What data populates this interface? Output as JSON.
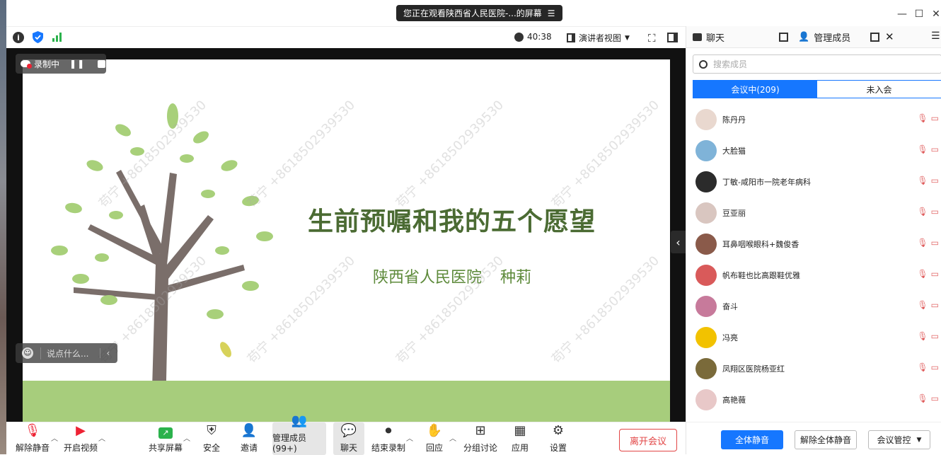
{
  "titlebar": {
    "share_notice": "您正在观看陕西省人民医院-...的屏幕",
    "minimize": "—",
    "maximize": "☐",
    "close": "✕"
  },
  "inforow": {
    "timer": "40:38",
    "view_mode": "演讲者视图"
  },
  "stage": {
    "recording_label": "录制中",
    "chat_placeholder": "说点什么...",
    "slide_title": "生前预嘱和我的五个愿望",
    "slide_hospital": "陕西省人民医院",
    "slide_presenter": "种莉",
    "watermark": "苟宁 +8618502939530"
  },
  "bottombar": {
    "unmute": "解除静音",
    "start_video": "开启视频",
    "share_screen": "共享屏幕",
    "security": "安全",
    "invite": "邀请",
    "manage_members": "管理成员(99+)",
    "chat": "聊天",
    "end_recording": "结束录制",
    "reactions": "回应",
    "breakout": "分组讨论",
    "apps": "应用",
    "settings": "设置",
    "leave": "离开会议"
  },
  "panel": {
    "tab_chat": "聊天",
    "tab_members": "管理成员",
    "search_placeholder": "搜索成员",
    "seg_in_meeting": "会议中(209)",
    "seg_not_joined": "未入会",
    "members": [
      {
        "name": "陈丹丹",
        "color": "#e9d8cf"
      },
      {
        "name": "大脸猫",
        "color": "#7fb3d8"
      },
      {
        "name": "丁敏-咸阳市一院老年病科",
        "color": "#2b2b2b"
      },
      {
        "name": "豆亚丽",
        "color": "#d9c6c0"
      },
      {
        "name": "耳鼻咽喉眼科+魏俊香",
        "color": "#8a5a4a"
      },
      {
        "name": "帆布鞋也比高跟鞋优雅",
        "color": "#d95a5a"
      },
      {
        "name": "奋斗",
        "color": "#c77a9b"
      },
      {
        "name": "冯亮",
        "color": "#f2c200"
      },
      {
        "name": "凤翔区医院杨亚红",
        "color": "#7a6a3a"
      },
      {
        "name": "高艳薇",
        "color": "#e8c8c8"
      }
    ],
    "mute_all": "全体静音",
    "unmute_all": "解除全体静音",
    "meeting_control": "会议管控"
  },
  "colors": {
    "accent": "#1677ff",
    "leave_red": "#e24545",
    "slide_title": "#4b6b33",
    "grass": "#a7cd7c"
  }
}
